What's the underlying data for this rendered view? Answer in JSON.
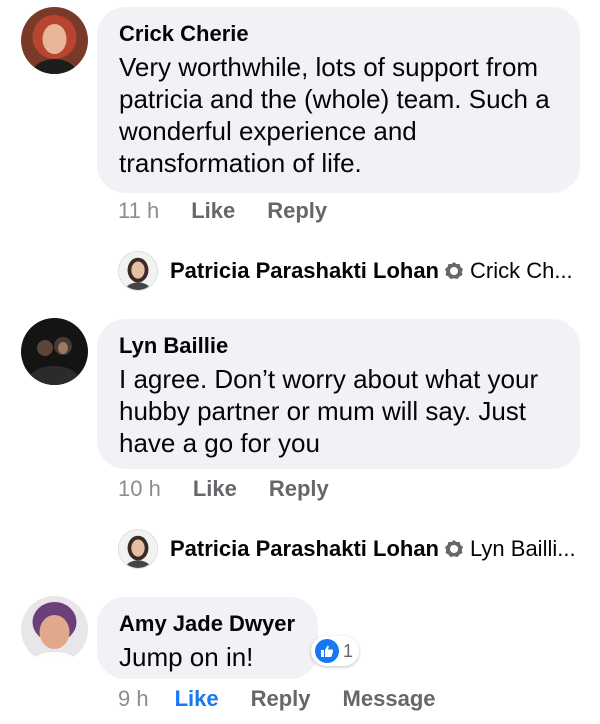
{
  "comments": [
    {
      "author": "Crick Cherie",
      "text": "Very worthwhile, lots of support from patricia and the (whole) team. Such a wonderful experience and transformation of life.",
      "time": "11 h",
      "like_label": "Like",
      "reply_label": "Reply",
      "reply": {
        "author": "Patricia Parashakti Lohan",
        "mention": "Crick Ch..."
      }
    },
    {
      "author": "Lyn Baillie",
      "text": "I agree. Don’t worry about what your hubby partner or mum will say. Just have a go for you",
      "time": "10 h",
      "like_label": "Like",
      "reply_label": "Reply",
      "reply": {
        "author": "Patricia Parashakti Lohan",
        "mention": "Lyn Bailli..."
      }
    },
    {
      "author": "Amy Jade Dwyer",
      "text": "Jump on in!",
      "time": "9 h",
      "like_label": "Like",
      "reply_label": "Reply",
      "message_label": "Message",
      "reaction_count": "1",
      "reaction_icon": "thumbs-up-icon",
      "liked": true
    }
  ],
  "colors": {
    "bubble": "#f0f2f5",
    "like_blue": "#1877f2",
    "meta_gray": "#65676b"
  }
}
